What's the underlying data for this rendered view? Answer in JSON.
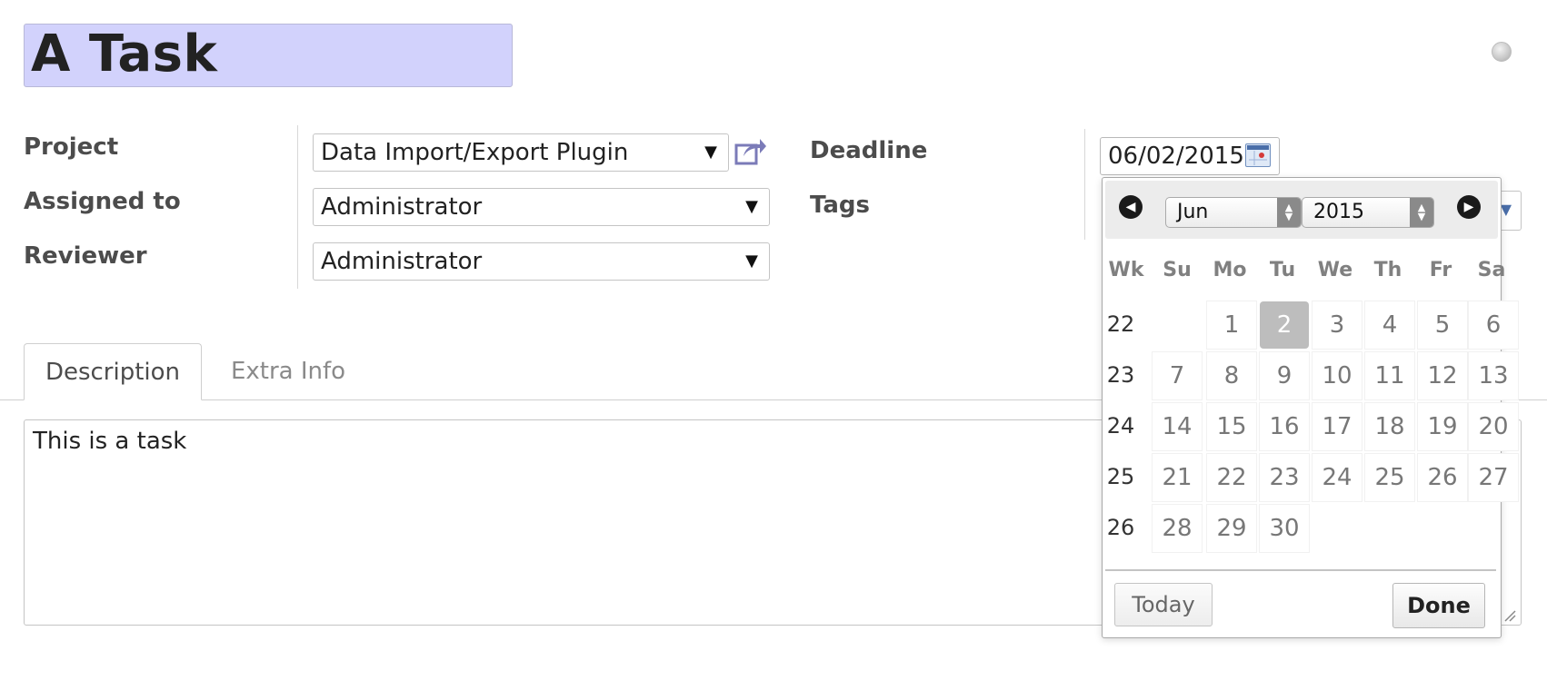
{
  "title": "A Task",
  "labels": {
    "project": "Project",
    "assigned_to": "Assigned to",
    "reviewer": "Reviewer",
    "deadline": "Deadline",
    "tags": "Tags"
  },
  "fields": {
    "project": "Data Import/Export Plugin",
    "assigned_to": "Administrator",
    "reviewer": "Administrator",
    "deadline": "06/02/2015"
  },
  "tabs": [
    {
      "label": "Description",
      "active": true
    },
    {
      "label": "Extra Info",
      "active": false
    }
  ],
  "description": "This is a task",
  "datepicker": {
    "month": "Jun",
    "year": "2015",
    "headers": [
      "Wk",
      "Su",
      "Mo",
      "Tu",
      "We",
      "Th",
      "Fr",
      "Sa"
    ],
    "weeks": [
      {
        "wk": "22",
        "days": [
          "",
          "1",
          "2",
          "3",
          "4",
          "5",
          "6"
        ]
      },
      {
        "wk": "23",
        "days": [
          "7",
          "8",
          "9",
          "10",
          "11",
          "12",
          "13"
        ]
      },
      {
        "wk": "24",
        "days": [
          "14",
          "15",
          "16",
          "17",
          "18",
          "19",
          "20"
        ]
      },
      {
        "wk": "25",
        "days": [
          "21",
          "22",
          "23",
          "24",
          "25",
          "26",
          "27"
        ]
      },
      {
        "wk": "26",
        "days": [
          "28",
          "29",
          "30",
          "",
          "",
          "",
          ""
        ]
      }
    ],
    "selected_day": "2",
    "today_label": "Today",
    "done_label": "Done"
  },
  "icons": {
    "external_link": "external-link-icon",
    "calendar": "calendar-icon",
    "prev": "prev-month-icon",
    "next": "next-month-icon",
    "dropdown": "chevron-down-icon"
  },
  "colors": {
    "title_bg": "#d2d2fc",
    "accent": "#7b7bb8",
    "selected_day_bg": "#bdbdbd"
  }
}
